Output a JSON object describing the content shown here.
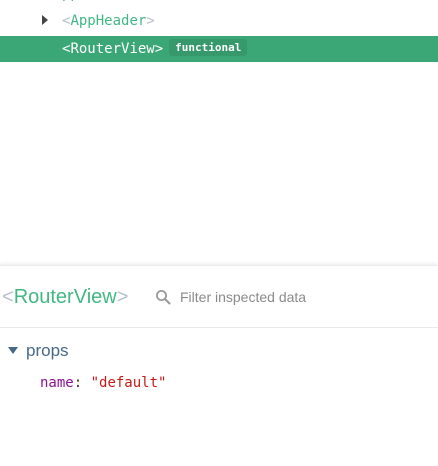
{
  "tree": {
    "partial_row_text": "pp",
    "nodes": [
      {
        "name": "AppHeader",
        "open_angle": "<",
        "close_angle": ">",
        "expandable": true,
        "selected": false
      },
      {
        "name": "RouterView",
        "open_angle": "<",
        "close_angle": ">",
        "expandable": false,
        "selected": true,
        "badge": "functional"
      }
    ]
  },
  "inspector": {
    "open_angle": "<",
    "close_angle": ">",
    "component_name": "RouterView",
    "filter_placeholder": "Filter inspected data",
    "filter_value": "",
    "search_icon": "search-icon",
    "sections": [
      {
        "label": "props",
        "expanded": true,
        "items": [
          {
            "key": "name",
            "separator": ":",
            "value": "\"default\""
          }
        ]
      }
    ]
  },
  "colors": {
    "vue_green": "#41b883",
    "selected_row": "#3ba776",
    "angle_gray": "#b5bfcc",
    "section_label": "#486887",
    "prop_key": "#881391",
    "prop_string": "#c41a16"
  }
}
